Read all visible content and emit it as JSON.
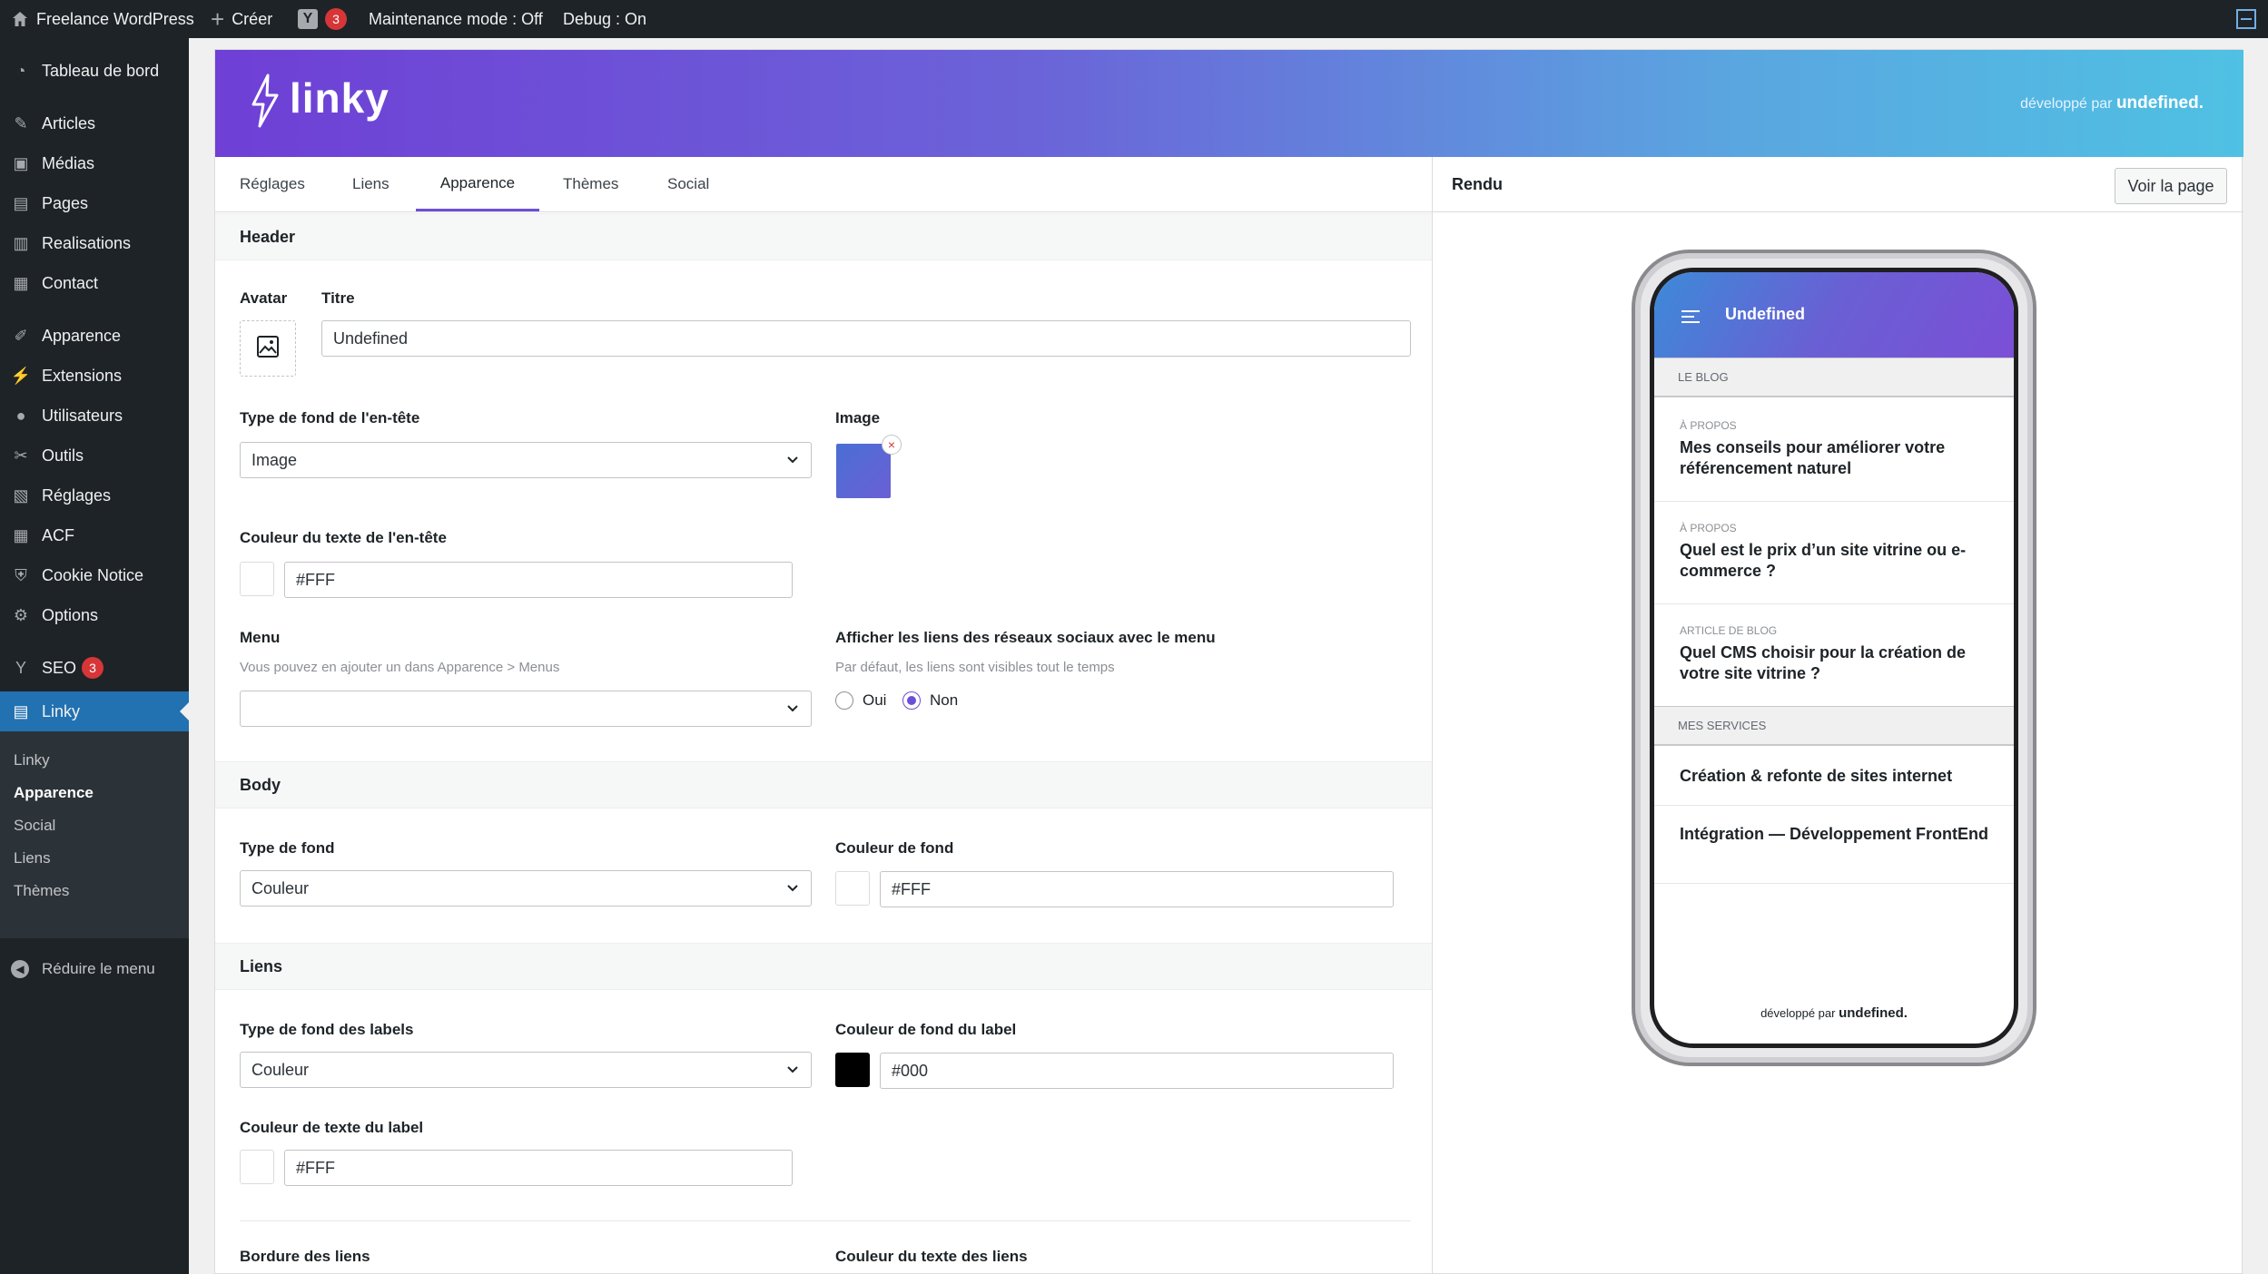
{
  "adminbar": {
    "site_name": "Freelance WordPress",
    "create_label": "Créer",
    "yoast_count": "3",
    "maintenance": "Maintenance mode : Off",
    "debug": "Debug : On"
  },
  "sidebar": {
    "dashboard": "Tableau de bord",
    "articles": "Articles",
    "medias": "Médias",
    "pages": "Pages",
    "realisations": "Realisations",
    "contact": "Contact",
    "apparence": "Apparence",
    "extensions": "Extensions",
    "utilisateurs": "Utilisateurs",
    "outils": "Outils",
    "reglages": "Réglages",
    "acf": "ACF",
    "cookie": "Cookie Notice",
    "options": "Options",
    "seo": "SEO",
    "seo_count": "3",
    "linky": "Linky",
    "submenu": [
      "Linky",
      "Apparence",
      "Social",
      "Liens",
      "Thèmes"
    ],
    "collapse": "Réduire le menu"
  },
  "banner": {
    "logo": "linky",
    "credit_prefix": "développé par",
    "credit_brand": "undefined."
  },
  "tabs": [
    "Réglages",
    "Liens",
    "Apparence",
    "Thèmes",
    "Social"
  ],
  "render": {
    "title": "Rendu",
    "view_button": "Voir la page"
  },
  "header_section": {
    "title": "Header",
    "avatar_label": "Avatar",
    "title_label": "Titre",
    "title_value": "Undefined",
    "bg_type_label": "Type de fond de l'en-tête",
    "bg_type_value": "Image",
    "image_label": "Image",
    "text_color_label": "Couleur du texte de l'en-tête",
    "text_color_value": "#FFF",
    "menu_label": "Menu",
    "menu_help": "Vous pouvez en ajouter un dans Apparence > Menus",
    "menu_value": "",
    "social_label": "Afficher les liens des réseaux sociaux avec le menu",
    "social_help": "Par défaut, les liens sont visibles tout le temps",
    "opt_yes": "Oui",
    "opt_no": "Non",
    "selected": "Non"
  },
  "body_section": {
    "title": "Body",
    "bg_type_label": "Type de fond",
    "bg_type_value": "Couleur",
    "bg_color_label": "Couleur de fond",
    "bg_color_value": "#FFF"
  },
  "links_section": {
    "title": "Liens",
    "label_bg_type_label": "Type de fond des labels",
    "label_bg_type_value": "Couleur",
    "label_bg_color_label": "Couleur de fond du label",
    "label_bg_color_value": "#000",
    "label_text_color_label": "Couleur de texte du label",
    "label_text_color_value": "#FFF",
    "border_label": "Bordure des liens",
    "link_text_color_label": "Couleur du texte des liens"
  },
  "preview": {
    "site_title": "Undefined",
    "section1": "Le blog",
    "items1": [
      {
        "category": "À propos",
        "title": "Mes conseils pour améliorer votre référencement naturel"
      },
      {
        "category": "À propos",
        "title": "Quel est le prix d’un site vitrine ou e-commerce ?"
      },
      {
        "category": "Article de blog",
        "title": "Quel CMS choisir pour la création de votre site vitrine ?"
      }
    ],
    "section2": "Mes services",
    "items2": [
      {
        "title": "Création & refonte de sites internet"
      },
      {
        "title": "Intégration — Développement FrontEnd"
      }
    ],
    "credit_prefix": "développé par",
    "credit_brand": "undefined."
  },
  "colors": {
    "accent": "#6b4fd8",
    "wp_blue": "#2271b1",
    "admin_dark": "#1d2327"
  }
}
